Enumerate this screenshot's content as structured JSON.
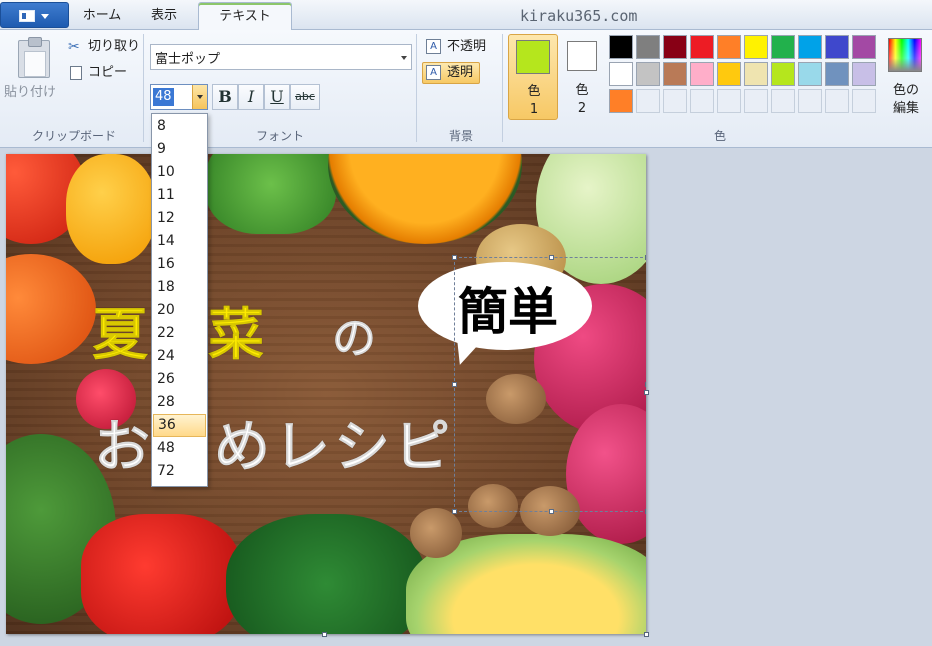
{
  "tabs": {
    "home": "ホーム",
    "view": "表示",
    "text": "テキスト"
  },
  "site_url": "kiraku365.com",
  "clipboard": {
    "paste": "貼り付け",
    "cut": "切り取り",
    "copy": "コピー",
    "group_title": "クリップボード"
  },
  "font": {
    "family": "富士ポップ",
    "size": "48",
    "bold": "B",
    "italic": "I",
    "underline": "U",
    "strike": "abc",
    "group_title": "フォント"
  },
  "background": {
    "opaque": "不透明",
    "transparent": "透明",
    "group_title": "背景"
  },
  "colors": {
    "color1_label": "色\n1",
    "color2_label": "色\n2",
    "edit_label": "色の\n編集",
    "group_title": "色",
    "color1_value": "#b5e61d",
    "color2_value": "#ffffff",
    "palette": [
      "#000000",
      "#7f7f7f",
      "#880015",
      "#ed1c24",
      "#ff7f27",
      "#fff200",
      "#22b14c",
      "#00a2e8",
      "#3f48cc",
      "#a349a4",
      "#ffffff",
      "#c3c3c3",
      "#b97a57",
      "#ffaec9",
      "#ffc90e",
      "#efe4b0",
      "#b5e61d",
      "#99d9ea",
      "#7092be",
      "#c8bfe7",
      "#ff7f27",
      "",
      "",
      "",
      "",
      "",
      "",
      "",
      "",
      ""
    ]
  },
  "size_list": {
    "options": [
      "8",
      "9",
      "10",
      "11",
      "12",
      "14",
      "16",
      "18",
      "20",
      "22",
      "24",
      "26",
      "28",
      "36",
      "48",
      "72"
    ],
    "highlighted": "36"
  },
  "canvas": {
    "title_part1": "夏野菜",
    "title_part2": "の",
    "title_line2": "お勧めレシピ",
    "bubble_text": "簡単"
  }
}
